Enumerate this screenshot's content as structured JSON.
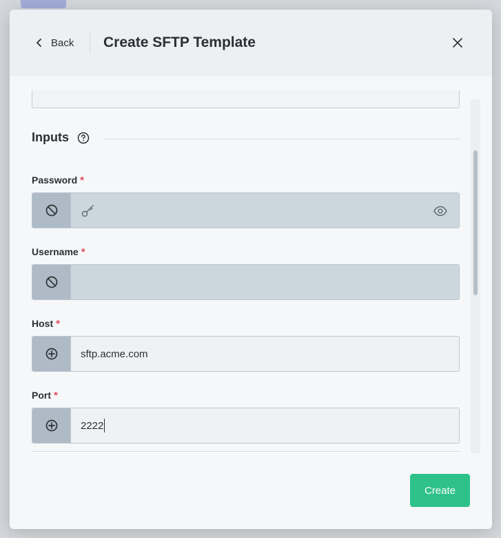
{
  "header": {
    "back_label": "Back",
    "title": "Create SFTP Template"
  },
  "inputs_section": {
    "title": "Inputs"
  },
  "fields": [
    {
      "label": "Password",
      "required_mark": "*",
      "value": "",
      "state": "disabled"
    },
    {
      "label": "Username",
      "required_mark": "*",
      "value": "",
      "state": "disabled"
    },
    {
      "label": "Host",
      "required_mark": "*",
      "value": "sftp.acme.com",
      "state": "enabled"
    },
    {
      "label": "Port",
      "required_mark": "*",
      "value": "2222",
      "state": "enabled"
    }
  ],
  "footer": {
    "create_label": "Create"
  },
  "colors": {
    "accent": "#2ec28a",
    "required": "#e04b5f",
    "prefix_bg": "#aebbc6"
  },
  "icons": {
    "back": "chevron-left-icon",
    "close": "close-icon",
    "help": "help-circle-icon",
    "disabled_prefix": "block-icon",
    "enabled_prefix": "plus-circle-icon",
    "password_key": "key-icon",
    "password_reveal": "eye-icon"
  }
}
